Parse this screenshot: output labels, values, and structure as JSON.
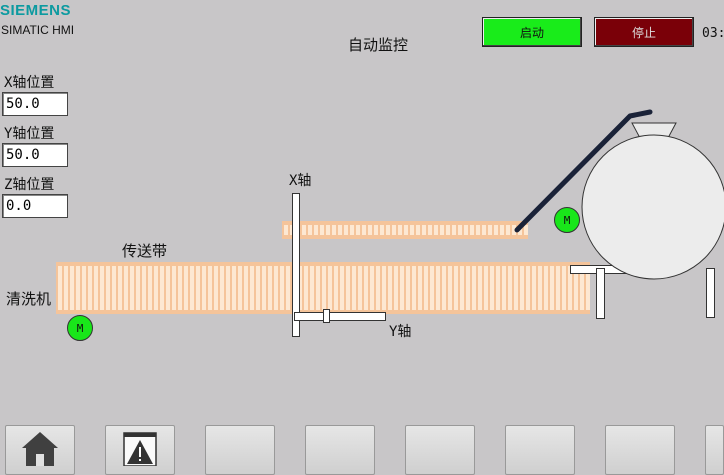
{
  "header": {
    "brand": "SIEMENS",
    "product": "SIMATIC HMI",
    "title": "自动监控",
    "start_label": "启动",
    "stop_label": "停止",
    "time": "03:"
  },
  "fields": {
    "x_label": "X轴位置",
    "x_value": "50.0",
    "y_label": "Y轴位置",
    "y_value": "50.0",
    "z_label": "Z轴位置",
    "z_value": "0.0"
  },
  "scene": {
    "conveyor_label": "传送带",
    "washer_label": "清洗机",
    "x_axis_label": "X轴",
    "y_axis_label": "Y轴",
    "motor_label": "M"
  },
  "colors": {
    "start": "#19ec1a",
    "stop": "#7a0008",
    "motor": "#19e61a",
    "conveyor": "#f5c49a",
    "brand": "#0c9aa0"
  },
  "nav": {
    "icons": [
      "home-icon",
      "alarm-icon",
      "",
      "",
      "",
      "",
      ""
    ]
  }
}
